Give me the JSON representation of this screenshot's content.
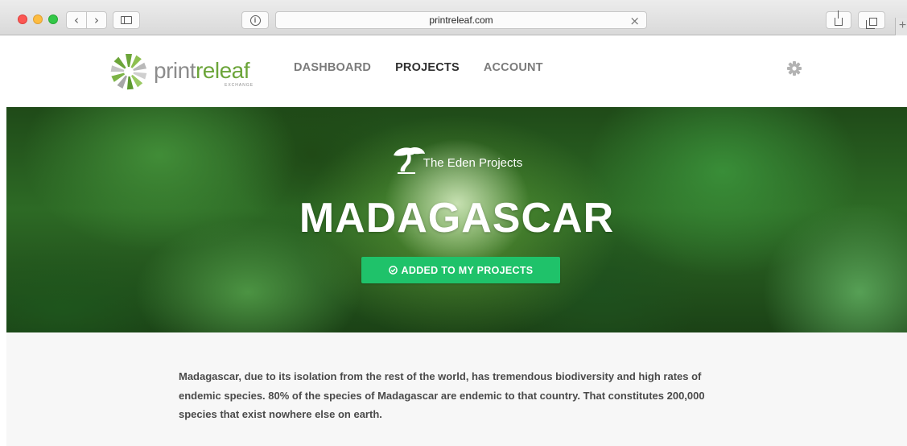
{
  "browser": {
    "url": "printreleaf.com",
    "new_tab_glyph": "+",
    "icons": [
      "back-icon",
      "forward-icon",
      "sidebar-icon",
      "privacy-info-icon",
      "close-icon",
      "share-icon",
      "tabs-icon"
    ]
  },
  "header": {
    "logo": {
      "part1": "print",
      "part2": "releaf",
      "sub": "EXCHANGE"
    },
    "nav": [
      {
        "label": "DASHBOARD",
        "active": false
      },
      {
        "label": "PROJECTS",
        "active": true
      },
      {
        "label": "ACCOUNT",
        "active": false
      }
    ],
    "settings_icon": "gear-icon"
  },
  "hero": {
    "partner": "The Eden Projects",
    "title": "MADAGASCAR",
    "button_label": "ADDED TO MY PROJECTS",
    "button_icon": "check-circle-icon"
  },
  "content": {
    "description": "Madagascar, due to its isolation from the rest of the world, has tremendous biodiversity and high rates of endemic species. 80% of the species of Madagascar are endemic to that country. That constitutes 200,000 species that exist nowhere else on earth."
  },
  "colors": {
    "brand_green": "#6ca53a",
    "brand_gray": "#8c8c8c",
    "button_green": "#1fc26a",
    "nav_active": "#303030",
    "nav_inactive": "#7b7b7b"
  }
}
